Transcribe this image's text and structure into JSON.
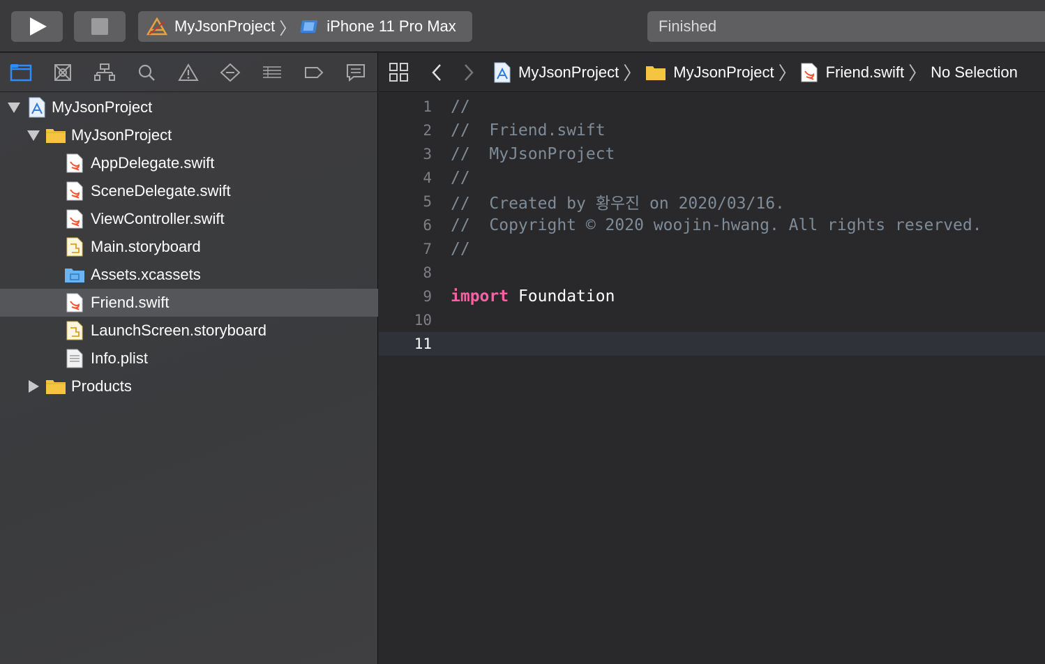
{
  "toolbar": {
    "scheme_project": "MyJsonProject",
    "scheme_device": "iPhone 11 Pro Max",
    "status": "Finished"
  },
  "navigator_tabs": [
    "project-navigator-icon",
    "source-control-icon",
    "symbol-navigator-icon",
    "find-icon",
    "issue-warning-icon",
    "test-navigator-icon",
    "debug-navigator-icon",
    "breakpoint-icon",
    "report-icon"
  ],
  "tree": {
    "root": "MyJsonProject",
    "group": "MyJsonProject",
    "files": [
      "AppDelegate.swift",
      "SceneDelegate.swift",
      "ViewController.swift",
      "Main.storyboard",
      "Assets.xcassets",
      "Friend.swift",
      "LaunchScreen.storyboard",
      "Info.plist"
    ],
    "products": "Products",
    "selected": "Friend.swift"
  },
  "jumpbar": {
    "project": "MyJsonProject",
    "group": "MyJsonProject",
    "file": "Friend.swift",
    "selection": "No Selection"
  },
  "code": {
    "line_numbers": [
      "1",
      "2",
      "3",
      "4",
      "5",
      "6",
      "7",
      "8",
      "9",
      "10",
      "11"
    ],
    "lines": [
      "//",
      "//  Friend.swift",
      "//  MyJsonProject",
      "//",
      "//  Created by 황우진 on 2020/03/16.",
      "//  Copyright © 2020 woojin-hwang. All rights reserved.",
      "//",
      "",
      "",
      "",
      ""
    ],
    "import_keyword": "import",
    "import_module": "Foundation",
    "current_line": 11
  },
  "colors": {
    "keyword": "#fc5fa3",
    "comment": "#7f8c98",
    "accent": "#2f8cff",
    "folder": "#f5c542"
  }
}
